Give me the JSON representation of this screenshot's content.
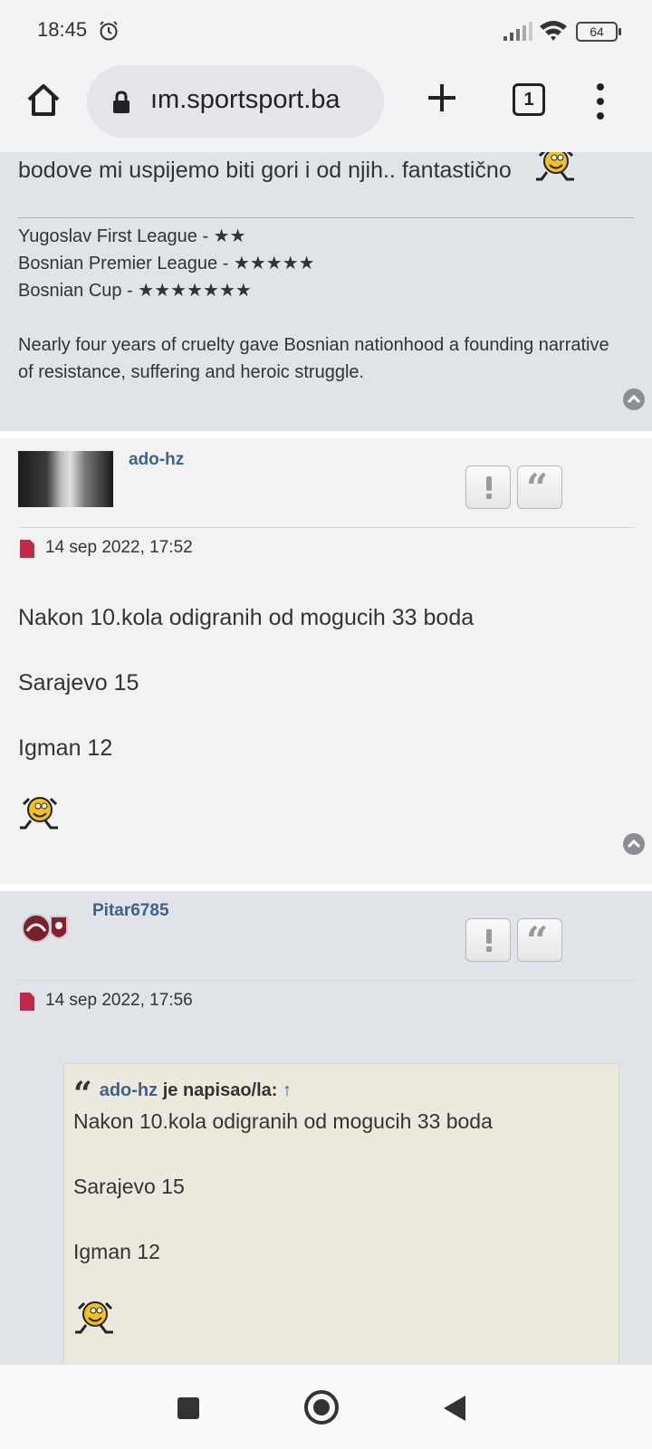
{
  "status_bar": {
    "time": "18:45",
    "battery": "64"
  },
  "browser": {
    "url": "ım.sportsport.ba",
    "tab_count": "1"
  },
  "post_prev": {
    "text": "bodove mi uspijemo biti gori i od njih.. fantastično",
    "signature_lines": [
      "Yugoslav First League - ★★",
      "Bosnian Premier League - ★★★★★",
      "Bosnian Cup - ★★★★★★★"
    ],
    "signature_quote": "Nearly four years of cruelty gave Bosnian nationhood a founding narrative of resistance, suffering and heroic struggle."
  },
  "post_1": {
    "username": "ado-hz",
    "timestamp": "14 sep 2022, 17:52",
    "lines": [
      "Nakon 10.kola odigranih od mogucih 33 boda",
      "Sarajevo 15",
      "Igman 12"
    ]
  },
  "post_2": {
    "username": "Pitar6785",
    "timestamp": "14 sep 2022, 17:56",
    "quote": {
      "author": "ado-hz",
      "wrote": "je napisao/la:",
      "arrow": "↑",
      "lines": [
        "Nakon 10.kola odigranih od mogucih 33 boda",
        "Sarajevo 15",
        "Igman 12"
      ]
    }
  },
  "icons": {
    "report": "exclamation-icon",
    "quote": "quote-icon",
    "back_to_top": "chevron-up-icon",
    "post_link": "file-icon"
  }
}
